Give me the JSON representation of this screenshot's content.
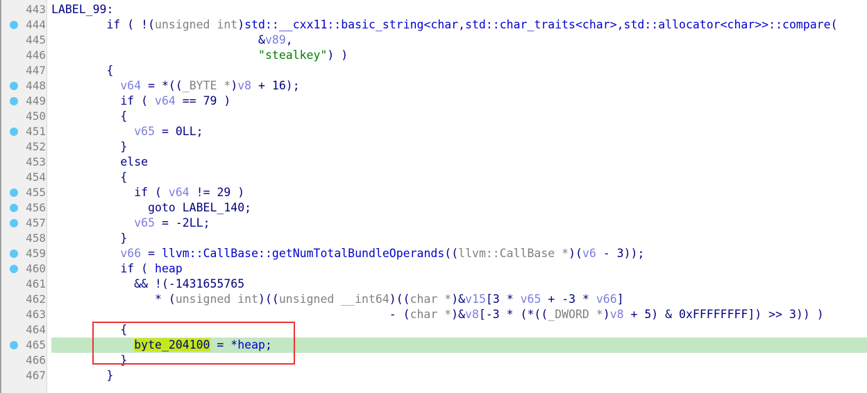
{
  "colors": {
    "breakpoint": "#5cc8f8",
    "current_line": "#c3e6c3",
    "highlight": "#c4e81c",
    "annotation_box": "#f03030"
  },
  "lines": [
    {
      "num": "443",
      "bp": false,
      "tokens": [
        [
          "k",
          "LABEL_99:"
        ]
      ]
    },
    {
      "num": "444",
      "bp": true,
      "tokens": [
        [
          "k",
          "        if ( !("
        ],
        [
          "t",
          "unsigned int"
        ],
        [
          "k",
          ")"
        ],
        [
          "f",
          "std::__cxx11::basic_string<char,std::char_traits<char>,std::allocator<char>>::compare"
        ],
        [
          "k",
          "("
        ]
      ]
    },
    {
      "num": "445",
      "bp": false,
      "tokens": [
        [
          "k",
          "                              &"
        ],
        [
          "v",
          "v89"
        ],
        [
          "k",
          ","
        ]
      ]
    },
    {
      "num": "446",
      "bp": false,
      "tokens": [
        [
          "k",
          "                              "
        ],
        [
          "s",
          "\"stealkey\""
        ],
        [
          "k",
          ") )"
        ]
      ]
    },
    {
      "num": "447",
      "bp": false,
      "tokens": [
        [
          "k",
          "        {"
        ]
      ]
    },
    {
      "num": "448",
      "bp": true,
      "tokens": [
        [
          "k",
          "          "
        ],
        [
          "v",
          "v64"
        ],
        [
          "k",
          " = *(("
        ],
        [
          "t",
          "_BYTE *"
        ],
        [
          "k",
          ")"
        ],
        [
          "v",
          "v8"
        ],
        [
          "k",
          " + 16);"
        ]
      ]
    },
    {
      "num": "449",
      "bp": true,
      "tokens": [
        [
          "k",
          "          if ( "
        ],
        [
          "v",
          "v64"
        ],
        [
          "k",
          " == 79 )"
        ]
      ]
    },
    {
      "num": "450",
      "bp": false,
      "tokens": [
        [
          "k",
          "          {"
        ]
      ]
    },
    {
      "num": "451",
      "bp": true,
      "tokens": [
        [
          "k",
          "            "
        ],
        [
          "v",
          "v65"
        ],
        [
          "k",
          " = 0LL;"
        ]
      ]
    },
    {
      "num": "452",
      "bp": false,
      "tokens": [
        [
          "k",
          "          }"
        ]
      ]
    },
    {
      "num": "453",
      "bp": false,
      "tokens": [
        [
          "k",
          "          else"
        ]
      ]
    },
    {
      "num": "454",
      "bp": false,
      "tokens": [
        [
          "k",
          "          {"
        ]
      ]
    },
    {
      "num": "455",
      "bp": true,
      "tokens": [
        [
          "k",
          "            if ( "
        ],
        [
          "v",
          "v64"
        ],
        [
          "k",
          " != 29 )"
        ]
      ]
    },
    {
      "num": "456",
      "bp": true,
      "tokens": [
        [
          "k",
          "              goto LABEL_140;"
        ]
      ]
    },
    {
      "num": "457",
      "bp": true,
      "tokens": [
        [
          "k",
          "            "
        ],
        [
          "v",
          "v65"
        ],
        [
          "k",
          " = -2LL;"
        ]
      ]
    },
    {
      "num": "458",
      "bp": false,
      "tokens": [
        [
          "k",
          "          }"
        ]
      ]
    },
    {
      "num": "459",
      "bp": true,
      "tokens": [
        [
          "k",
          "          "
        ],
        [
          "v",
          "v66"
        ],
        [
          "k",
          " = "
        ],
        [
          "f",
          "llvm::CallBase::getNumTotalBundleOperands"
        ],
        [
          "k",
          "(("
        ],
        [
          "t",
          "llvm::CallBase *"
        ],
        [
          "k",
          ")("
        ],
        [
          "v",
          "v6"
        ],
        [
          "k",
          " - 3));"
        ]
      ]
    },
    {
      "num": "460",
      "bp": true,
      "tokens": [
        [
          "k",
          "          if ( "
        ],
        [
          "f",
          "heap"
        ]
      ]
    },
    {
      "num": "461",
      "bp": false,
      "tokens": [
        [
          "k",
          "            && !(-1431655765"
        ]
      ]
    },
    {
      "num": "462",
      "bp": false,
      "tokens": [
        [
          "k",
          "               * ("
        ],
        [
          "t",
          "unsigned int"
        ],
        [
          "k",
          ")(("
        ],
        [
          "t",
          "unsigned __int64"
        ],
        [
          "k",
          ")(("
        ],
        [
          "t",
          "char *"
        ],
        [
          "k",
          ")&"
        ],
        [
          "v",
          "v15"
        ],
        [
          "k",
          "[3 * "
        ],
        [
          "v",
          "v65"
        ],
        [
          "k",
          " + -3 * "
        ],
        [
          "v",
          "v66"
        ],
        [
          "k",
          "]"
        ]
      ]
    },
    {
      "num": "463",
      "bp": false,
      "tokens": [
        [
          "k",
          "                                                 - ("
        ],
        [
          "t",
          "char *"
        ],
        [
          "k",
          ")&"
        ],
        [
          "v",
          "v8"
        ],
        [
          "k",
          "[-3 * (*(("
        ],
        [
          "t",
          "_DWORD *"
        ],
        [
          "k",
          ")"
        ],
        [
          "v",
          "v8"
        ],
        [
          "k",
          " + 5) & 0xFFFFFFFF]) >> 3)) )"
        ]
      ]
    },
    {
      "num": "464",
      "bp": false,
      "tokens": [
        [
          "k",
          "          {"
        ]
      ]
    },
    {
      "num": "465",
      "bp": true,
      "current": true,
      "tokens": [
        [
          "k",
          "            "
        ],
        [
          "hl",
          "byte_204100"
        ],
        [
          "k",
          " = *"
        ],
        [
          "f",
          "heap"
        ],
        [
          "k",
          ";"
        ]
      ]
    },
    {
      "num": "466",
      "bp": false,
      "tokens": [
        [
          "k",
          "          }"
        ]
      ]
    },
    {
      "num": "467",
      "bp": false,
      "tokens": [
        [
          "k",
          "        }"
        ]
      ]
    }
  ]
}
